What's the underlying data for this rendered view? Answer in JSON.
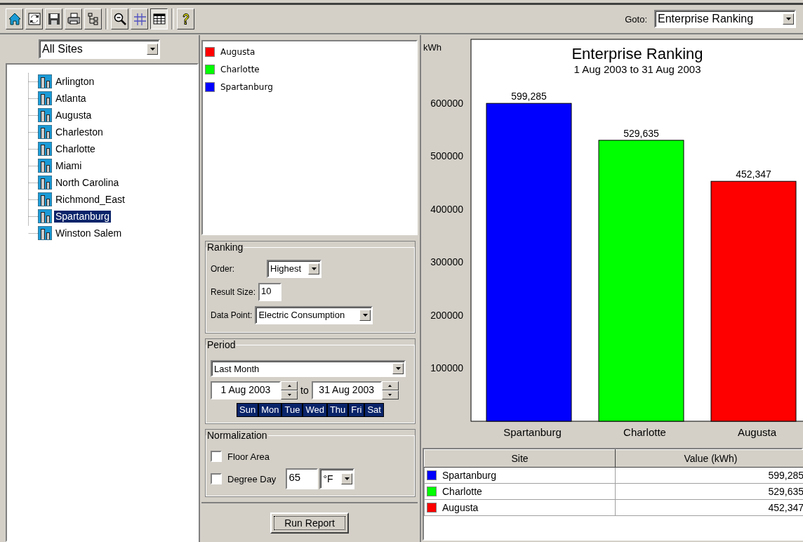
{
  "toolbar": {
    "tools": [
      {
        "kind": "home",
        "pressed": false
      },
      {
        "kind": "refresh",
        "pressed": false
      },
      {
        "kind": "save",
        "pressed": false
      },
      {
        "kind": "print",
        "pressed": false
      },
      {
        "kind": "tree",
        "pressed": false
      },
      {
        "kind": "zoom",
        "pressed": false
      },
      {
        "kind": "grid",
        "pressed": false
      },
      {
        "kind": "table",
        "pressed": true
      },
      {
        "kind": "help",
        "pressed": false
      }
    ],
    "goto": {
      "label": "Goto:",
      "value": "Enterprise Ranking"
    }
  },
  "sites_panel": {
    "filter": "All Sites",
    "tree": [
      {
        "label": "Arlington",
        "selected": false
      },
      {
        "label": "Atlanta",
        "selected": false
      },
      {
        "label": "Augusta",
        "selected": false
      },
      {
        "label": "Charleston",
        "selected": false
      },
      {
        "label": "Charlotte",
        "selected": false
      },
      {
        "label": "Miami",
        "selected": false
      },
      {
        "label": "North Carolina",
        "selected": false
      },
      {
        "label": "Richmond_East",
        "selected": false
      },
      {
        "label": "Spartanburg",
        "selected": true
      },
      {
        "label": "Winston Salem",
        "selected": false
      }
    ]
  },
  "ranking": {
    "title": "Ranking",
    "fields": [
      {
        "kind": "select",
        "label": "Order:",
        "value": "Highest"
      },
      {
        "kind": "input",
        "label": "Result Size:",
        "value": "10"
      },
      {
        "kind": "select",
        "label": "Data Point:",
        "value": "Electric Consumption"
      }
    ]
  },
  "period": {
    "title": "Period",
    "range": "Last Month",
    "from": "1 Aug 2003",
    "to_label": "to",
    "to": "31 Aug 2003",
    "days": [
      {
        "label": "Sun",
        "selected": true
      },
      {
        "label": "Mon",
        "selected": true
      },
      {
        "label": "Tue",
        "selected": true
      },
      {
        "label": "Wed",
        "selected": true
      },
      {
        "label": "Thu",
        "selected": true
      },
      {
        "label": "Fri",
        "selected": true
      },
      {
        "label": "Sat",
        "selected": true
      }
    ]
  },
  "normalization": {
    "title": "Normalization",
    "options": [
      {
        "kind": "checkbox",
        "label": "Floor Area",
        "checked": false
      },
      {
        "kind": "degree",
        "label": "Degree Day",
        "checked": false,
        "value": "65",
        "unit": "°F"
      }
    ]
  },
  "run_button": "Run Report",
  "chart": {
    "subtitle": "1 Aug 2003 to 31 Aug 2003",
    "chart_data": {
      "type": "bar",
      "title": "Enterprise Ranking",
      "ylabel": "kWh",
      "categories": [
        "Spartanburg",
        "Charlotte",
        "Augusta"
      ],
      "series": [
        {
          "name": "Augusta",
          "color": "#ff0000",
          "values": [
            null,
            null,
            452347
          ],
          "value_labels": [
            null,
            null,
            "452,347"
          ]
        },
        {
          "name": "Charlotte",
          "color": "#00ff00",
          "values": [
            null,
            529635,
            null
          ],
          "value_labels": [
            null,
            "529,635",
            null
          ]
        },
        {
          "name": "Spartanburg",
          "color": "#0000ff",
          "values": [
            599285,
            null,
            null
          ],
          "value_labels": [
            "599,285",
            null,
            null
          ]
        }
      ],
      "ylim": [
        0,
        720000
      ],
      "yticks": [
        100000,
        200000,
        300000,
        400000,
        500000,
        600000
      ]
    }
  },
  "table": {
    "columns": [
      "Site",
      "Value (kWh)"
    ],
    "rows": [
      {
        "site": "Spartanburg",
        "color": "#0000ff",
        "value": "599,285"
      },
      {
        "site": "Charlotte",
        "color": "#00ff00",
        "value": "529,635"
      },
      {
        "site": "Augusta",
        "color": "#ff0000",
        "value": "452,347"
      }
    ]
  }
}
